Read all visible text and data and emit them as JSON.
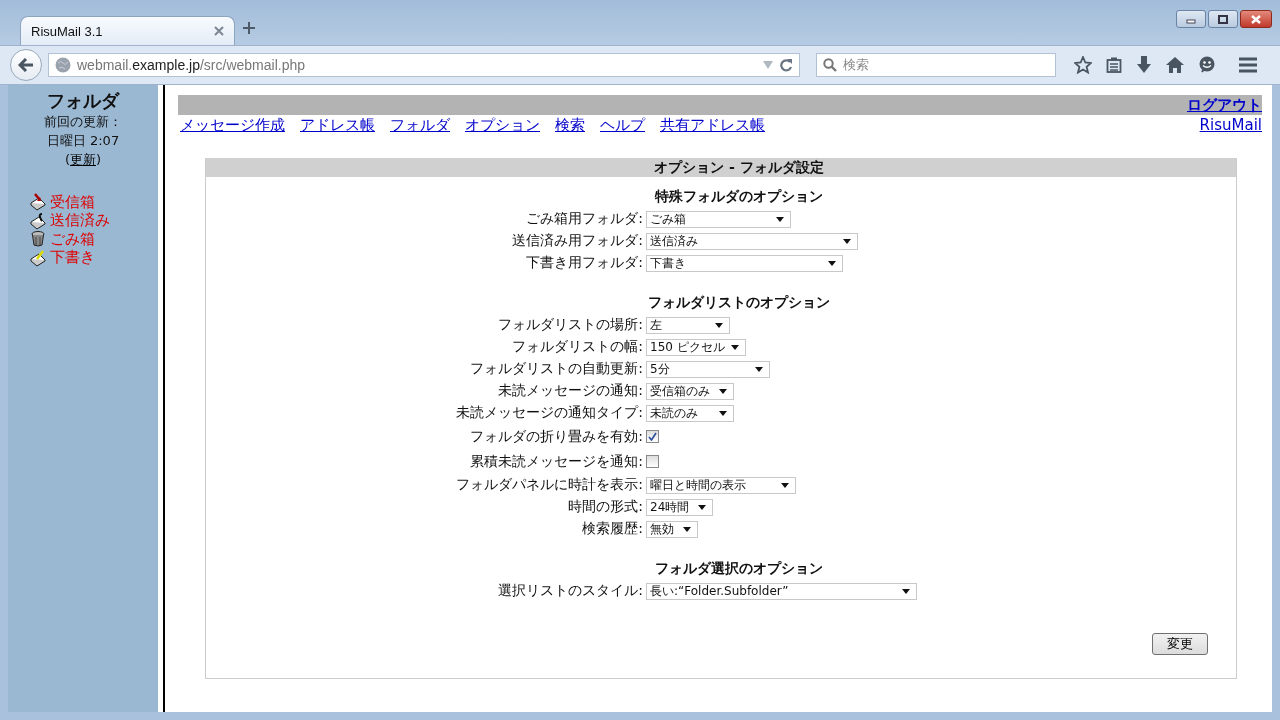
{
  "browser": {
    "tab_title": "RisuMail 3.1",
    "url": {
      "prefix": "webmail.",
      "domain": "example.jp",
      "path": "/src/webmail.php"
    },
    "search_placeholder": "検索"
  },
  "sidebar": {
    "title": "フォルダ",
    "last_update_label": "前回の更新：",
    "last_update": "日曜日 2:07",
    "refresh": {
      "open": "(",
      "link": "更新",
      "close": ")"
    },
    "folders": [
      {
        "label": "受信箱",
        "kind": "inbox"
      },
      {
        "label": "送信済み",
        "kind": "sent"
      },
      {
        "label": "ごみ箱",
        "kind": "trash"
      },
      {
        "label": "下書き",
        "kind": "drafts"
      }
    ]
  },
  "top_bar": {
    "logout": "ログアウト",
    "nav": [
      "メッセージ作成",
      "アドレス帳",
      "フォルダ",
      "オプション",
      "検索",
      "ヘルプ",
      "共有アドレス帳"
    ],
    "brand_link": "RisuMail"
  },
  "options": {
    "title": "オプション - フォルダ設定",
    "sections": [
      {
        "title": "特殊フォルダのオプション",
        "rows": [
          {
            "label": "ごみ箱用フォルダ:",
            "kind": "select",
            "value": "ごみ箱"
          },
          {
            "label": "送信済み用フォルダ:",
            "kind": "select",
            "value": "送信済み"
          },
          {
            "label": "下書き用フォルダ:",
            "kind": "select",
            "value": "下書き"
          }
        ]
      },
      {
        "title": "フォルダリストのオプション",
        "rows": [
          {
            "label": "フォルダリストの場所:",
            "kind": "select",
            "value": "左"
          },
          {
            "label": "フォルダリストの幅:",
            "kind": "select",
            "value": "150 ピクセル"
          },
          {
            "label": "フォルダリストの自動更新:",
            "kind": "select",
            "value": "5分"
          },
          {
            "label": "未読メッセージの通知:",
            "kind": "select",
            "value": "受信箱のみ"
          },
          {
            "label": "未読メッセージの通知タイプ:",
            "kind": "select",
            "value": "未読のみ"
          },
          {
            "label": "フォルダの折り畳みを有効:",
            "kind": "checkbox",
            "checked": true
          },
          {
            "label": "累積未読メッセージを通知:",
            "kind": "checkbox",
            "checked": false
          },
          {
            "label": "フォルダパネルに時計を表示:",
            "kind": "select",
            "value": "曜日と時間の表示"
          },
          {
            "label": "時間の形式:",
            "kind": "select",
            "value": "24時間"
          },
          {
            "label": "検索履歴:",
            "kind": "select",
            "value": "無効"
          }
        ]
      },
      {
        "title": "フォルダ選択のオプション",
        "rows": [
          {
            "label": "選択リストのスタイル:",
            "kind": "select",
            "value": "長い:“Folder.Subfolder”"
          }
        ]
      }
    ],
    "submit": "変更"
  }
}
